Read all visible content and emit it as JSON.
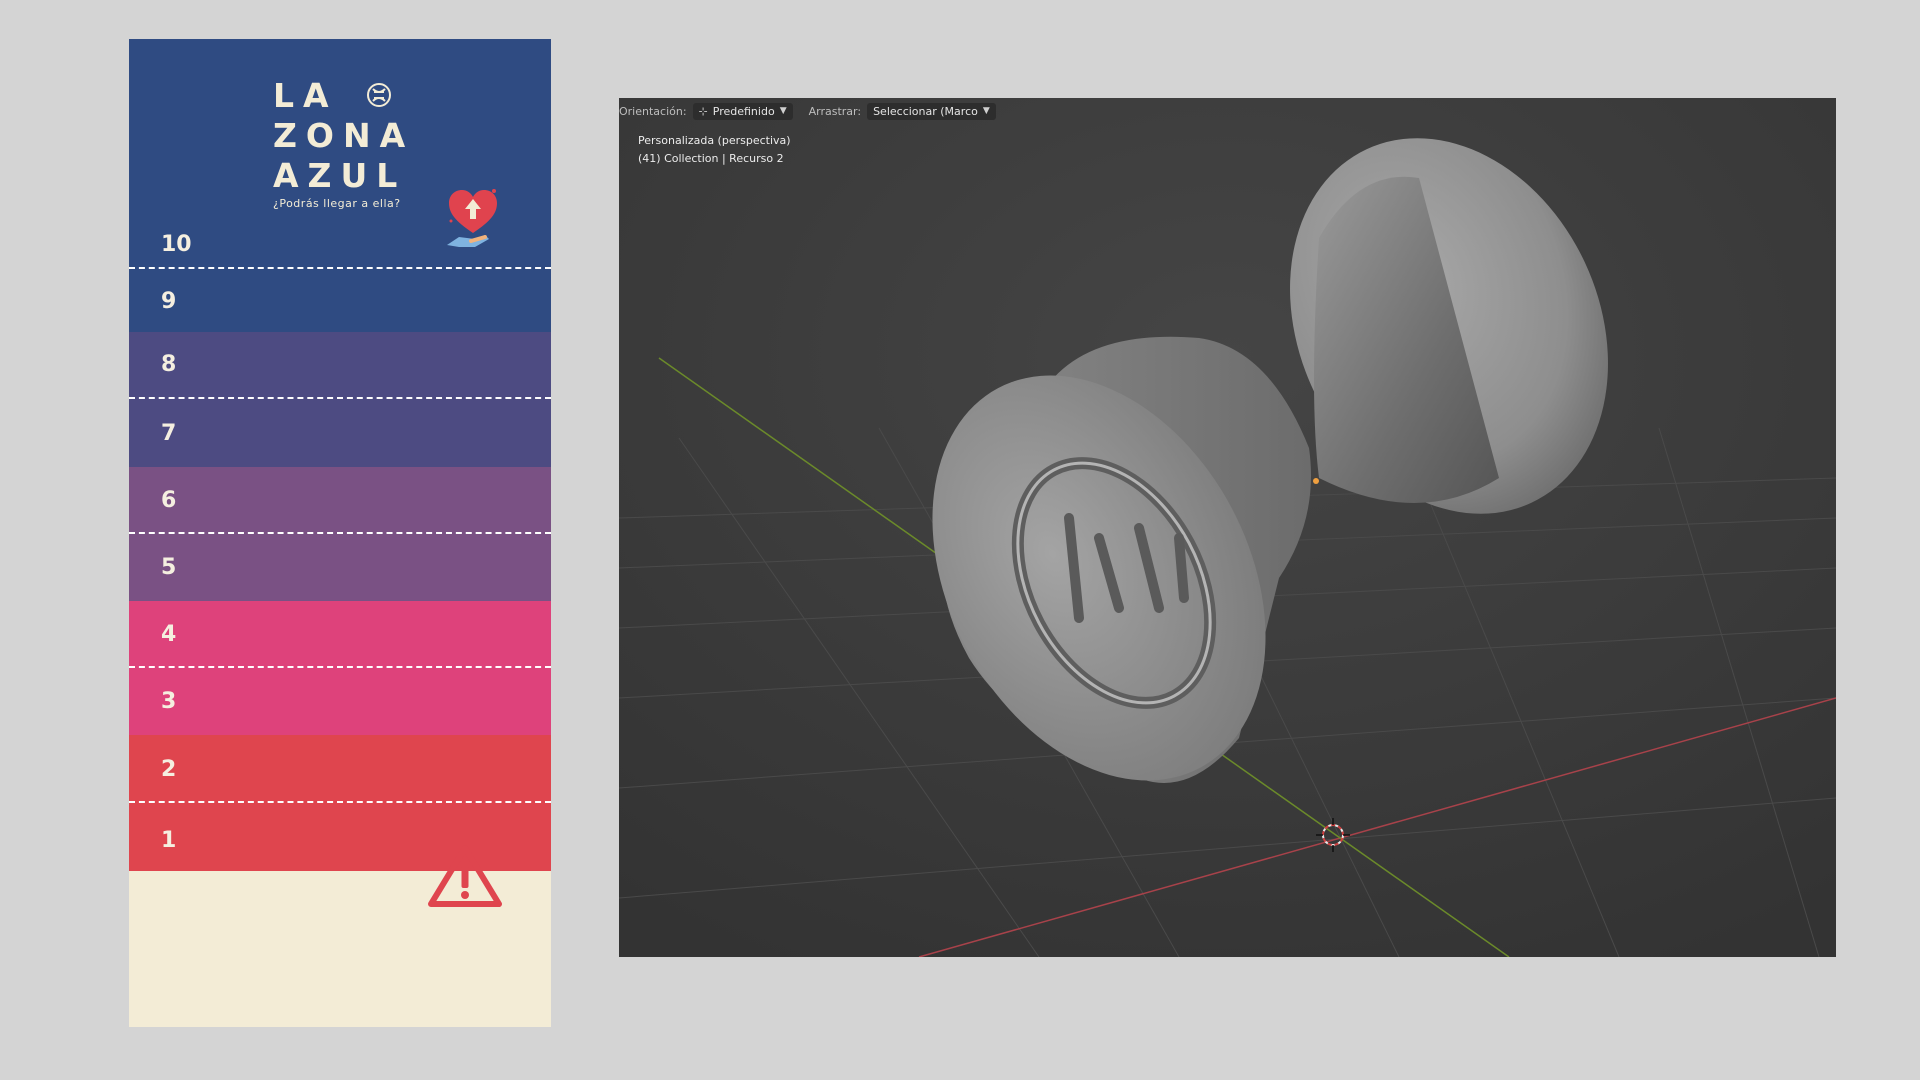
{
  "card": {
    "logo_line1": "LA",
    "logo_line2": "ZONA",
    "logo_line3": "AZUL",
    "tagline": "¿Podrás llegar a ella?",
    "levels": [
      {
        "num": "10",
        "color": "#2f4b82"
      },
      {
        "num": "9",
        "color": "#2f4b82"
      },
      {
        "num": "8",
        "color": "#4d4b82"
      },
      {
        "num": "7",
        "color": "#4d4b82"
      },
      {
        "num": "6",
        "color": "#7a5184"
      },
      {
        "num": "5",
        "color": "#7a5184"
      },
      {
        "num": "4",
        "color": "#de427b"
      },
      {
        "num": "3",
        "color": "#de427b"
      },
      {
        "num": "2",
        "color": "#df454e"
      },
      {
        "num": "1",
        "color": "#df454e"
      }
    ],
    "footer_color": "#f3ecd6",
    "icons": [
      "dna-icon",
      "heart-hand-icon",
      "warning-icon"
    ]
  },
  "viewport": {
    "toolbar": {
      "orientation_label": "Orientación:",
      "orientation_value": "Predefinido",
      "drag_label": "Arrastrar:",
      "drag_value": "Seleccionar (Marco"
    },
    "view_name": "Personalizada (perspectiva)",
    "collection_info": "(41) Collection | Recurso 2",
    "colors": {
      "background": "#3b3b3b",
      "x_axis": "#a8424a",
      "y_axis": "#6b8a2a",
      "object": "#8c8c8c"
    }
  }
}
